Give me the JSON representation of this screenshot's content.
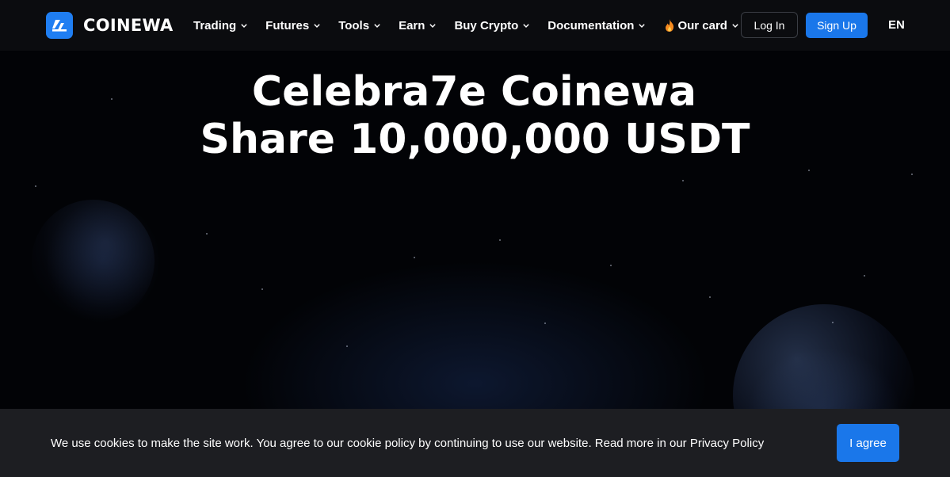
{
  "brand": {
    "name": "COINEWA",
    "logo_icon": "coinewa-logo-icon",
    "accent": "#1f7ef2"
  },
  "nav": {
    "items": [
      {
        "label": "Trading",
        "icon": "chevron-down-icon"
      },
      {
        "label": "Futures",
        "icon": "chevron-down-icon"
      },
      {
        "label": "Tools",
        "icon": "chevron-down-icon"
      },
      {
        "label": "Earn",
        "icon": "chevron-down-icon"
      },
      {
        "label": "Buy Crypto",
        "icon": "chevron-down-icon"
      },
      {
        "label": "Documentation",
        "icon": "chevron-down-icon"
      },
      {
        "label": "Our card",
        "icon": "chevron-down-icon",
        "prefix_icon": "fire-icon"
      }
    ],
    "login_label": "Log In",
    "signup_label": "Sign Up",
    "language": "EN"
  },
  "hero": {
    "title_line1": "Celebra7e Coinewa",
    "title_line2": "Share 10,000,000 USDT"
  },
  "cookie_banner": {
    "text": "We use cookies to make the site work. You agree to our cookie policy by continuing to use our website. Read more in our Privacy Policy",
    "agree_label": "I agree"
  }
}
